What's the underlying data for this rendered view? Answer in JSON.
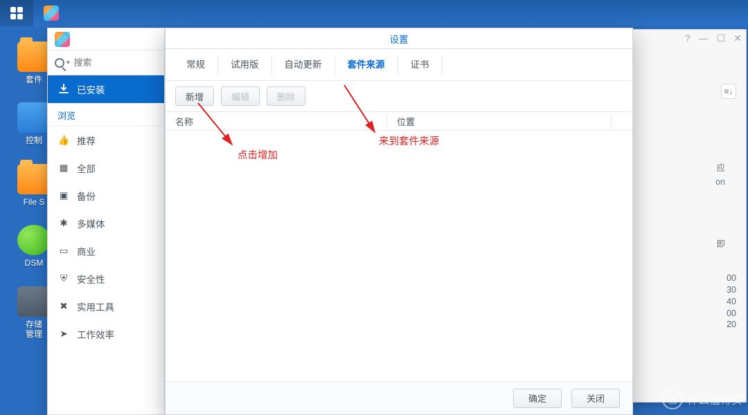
{
  "desktop": {
    "items": [
      {
        "label": "套件"
      },
      {
        "label": "控制"
      },
      {
        "label": "File S"
      },
      {
        "label": "DSM"
      },
      {
        "label": "存储\n管理"
      }
    ]
  },
  "package_center": {
    "search_placeholder": "搜索",
    "installed_label": "已安装",
    "browse_header": "浏览",
    "categories": [
      {
        "label": "推荐"
      },
      {
        "label": "全部"
      },
      {
        "label": "备份"
      },
      {
        "label": "多媒体"
      },
      {
        "label": "商业"
      },
      {
        "label": "安全性"
      },
      {
        "label": "实用工具"
      },
      {
        "label": "工作效率"
      }
    ]
  },
  "settings_dialog": {
    "title": "设置",
    "tabs": [
      "常规",
      "试用版",
      "自动更新",
      "套件来源",
      "证书"
    ],
    "active_tab_index": 3,
    "toolbar": {
      "add": "新增",
      "edit": "编辑",
      "delete": "删除"
    },
    "table": {
      "col_name": "名称",
      "col_location": "位置"
    },
    "footer": {
      "ok": "确定",
      "close": "关闭"
    }
  },
  "back_window": {
    "frag1a": "应",
    "frag1b": "on",
    "frag2": "即",
    "frag3": "00\n30\n40\n00\n20"
  },
  "annotations": {
    "arrow1_label": "点击增加",
    "arrow2_label": "来到套件来源"
  },
  "watermark": {
    "badge": "值",
    "text": "什么值得买"
  }
}
